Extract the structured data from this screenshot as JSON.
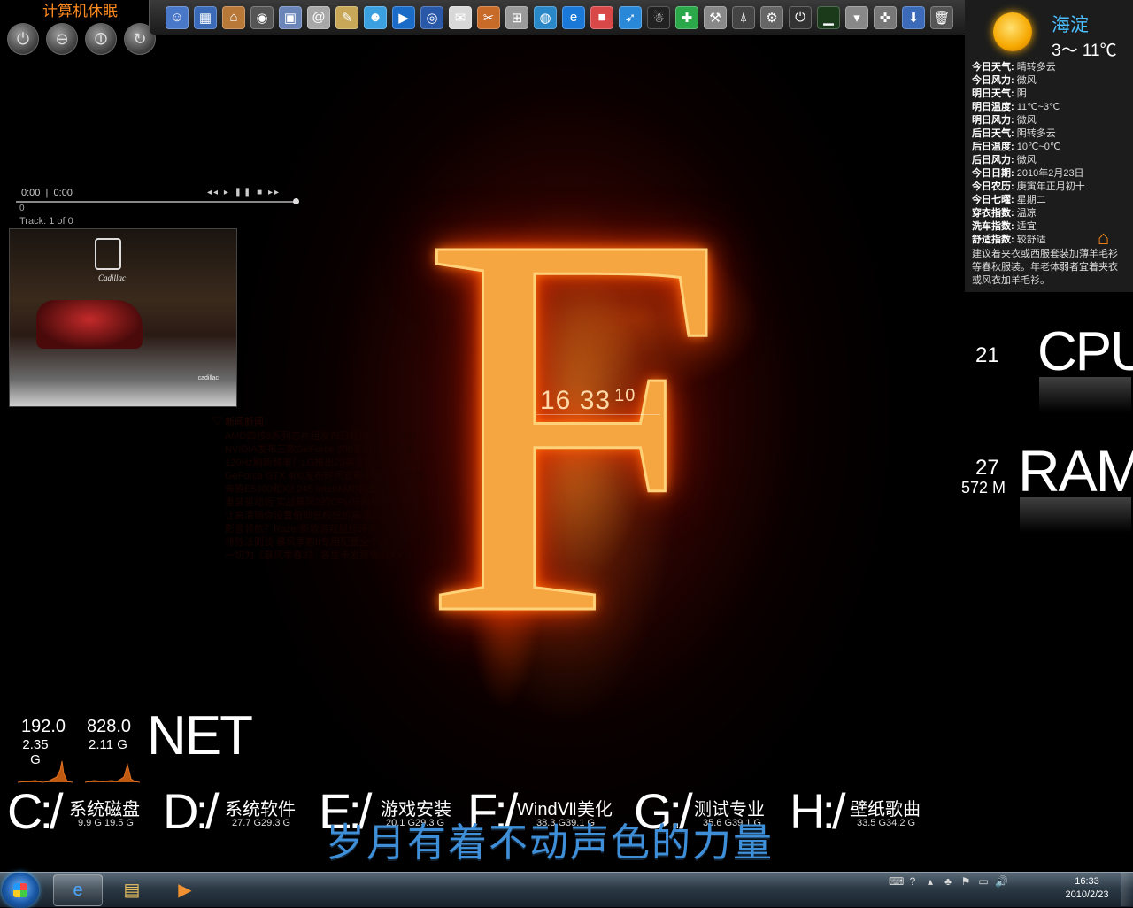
{
  "desktop": {
    "flame_clock": {
      "hm": "16 33",
      "sec": "10"
    },
    "slogan": "岁月有着不动声色的力量"
  },
  "shutdown_gadget": {
    "title": "计算机休眠",
    "buttons": [
      {
        "name": "shutdown",
        "glyph": "⏻"
      },
      {
        "name": "logoff",
        "glyph": "⊖"
      },
      {
        "name": "restart",
        "glyph": "⏼"
      },
      {
        "name": "refresh",
        "glyph": "↻"
      }
    ]
  },
  "dock": {
    "items": [
      {
        "name": "finder-icon",
        "glyph": "☺",
        "color": "#4a78c8"
      },
      {
        "name": "windows-icon",
        "glyph": "▦",
        "color": "#3a6ab8"
      },
      {
        "name": "home-icon",
        "glyph": "⌂",
        "color": "#b87838"
      },
      {
        "name": "gauge-icon",
        "glyph": "◉",
        "color": "#555555"
      },
      {
        "name": "photo-icon",
        "glyph": "▣",
        "color": "#6a86b8"
      },
      {
        "name": "mail-icon",
        "glyph": "@",
        "color": "#a8a8a8"
      },
      {
        "name": "note-icon",
        "glyph": "✎",
        "color": "#c8a858"
      },
      {
        "name": "msn-icon",
        "glyph": "☻",
        "color": "#3aa0e0"
      },
      {
        "name": "play-icon",
        "glyph": "▶",
        "color": "#1a6ac8"
      },
      {
        "name": "browser-icon",
        "glyph": "◎",
        "color": "#2a58a8"
      },
      {
        "name": "document-icon",
        "glyph": "✉",
        "color": "#d8d8d8"
      },
      {
        "name": "ruler-icon",
        "glyph": "✂",
        "color": "#c86a28"
      },
      {
        "name": "calculator-icon",
        "glyph": "⊞",
        "color": "#9a9a9a"
      },
      {
        "name": "globe-icon",
        "glyph": "◍",
        "color": "#2a88c8"
      },
      {
        "name": "ie-icon",
        "glyph": "e",
        "color": "#1a78d8"
      },
      {
        "name": "cube-icon",
        "glyph": "■",
        "color": "#d84848"
      },
      {
        "name": "bird-icon",
        "glyph": "➶",
        "color": "#2a88d8"
      },
      {
        "name": "qq-icon",
        "glyph": "☃",
        "color": "#222222"
      },
      {
        "name": "shield-icon",
        "glyph": "✚",
        "color": "#2aa84a"
      },
      {
        "name": "tools-icon",
        "glyph": "⚒",
        "color": "#888888"
      },
      {
        "name": "hanger-icon",
        "glyph": "⍋",
        "color": "#444444"
      },
      {
        "name": "settings-icon",
        "glyph": "⚙",
        "color": "#666666"
      },
      {
        "name": "power-icon",
        "glyph": "⏻",
        "color": "#333333"
      },
      {
        "name": "chart-icon",
        "glyph": "▁",
        "color": "#1a3a1a"
      },
      {
        "name": "arrow-icon",
        "glyph": "▾",
        "color": "#888888"
      },
      {
        "name": "gamepad-icon",
        "glyph": "✜",
        "color": "#777777"
      },
      {
        "name": "download-icon",
        "glyph": "⬇",
        "color": "#3a6ab8"
      },
      {
        "name": "trash-icon",
        "glyph": "🗑",
        "color": "#555555"
      }
    ]
  },
  "player": {
    "time_current": "0:00",
    "time_total": "0:00",
    "controls": "◂◂ ▸ ❚❚ ■ ▸▸",
    "counter": "0",
    "track": "Track: 1 of 0"
  },
  "photo": {
    "brand": "Cadillac",
    "brand_small": "cadillac"
  },
  "news": {
    "header": "▽ 新闻新闻",
    "items": [
      "AMD四核8系列芯片组发布日程确定 4月26日",
      "NVIDIA发布三款GeForce 300系列OEM显卡",
      "120Hz刷新频率！LG推出23英寸3D液晶",
      "GeForce GTX 400发布时间宣布 将等待一个月",
      "奔腾E5300和X2 245 Intel/AMD销量王PK",
      "重装驱动后 实战暴风2的CPU与内存需求",
      "让高清随你设置俯仰低权低价高清显卡推荐",
      "影音领航？Razer新款游戏鼠标评测",
      "排除法则谈 暴风季春II专用配置全个评",
      "一切为《暴风季春2》 各显卡发挥情况大PK"
    ]
  },
  "weather": {
    "city": "海淀",
    "temp": "3～ 11℃",
    "rows": [
      {
        "k": "今日天气:",
        "v": "晴转多云"
      },
      {
        "k": "今日风力:",
        "v": "微风"
      },
      {
        "k": "明日天气:",
        "v": "阴"
      },
      {
        "k": "明日温度:",
        "v": "11℃~3℃"
      },
      {
        "k": "明日风力:",
        "v": "微风"
      },
      {
        "k": "后日天气:",
        "v": "阴转多云"
      },
      {
        "k": "后日温度:",
        "v": "10℃~0℃"
      },
      {
        "k": "后日风力:",
        "v": "微风"
      },
      {
        "k": "今日日期:",
        "v": "2010年2月23日"
      },
      {
        "k": "今日农历:",
        "v": "庚寅年正月初十"
      },
      {
        "k": "今日七曜:",
        "v": "星期二"
      },
      {
        "k": "穿衣指数:",
        "v": "温凉"
      },
      {
        "k": "洗车指数:",
        "v": "适宜"
      },
      {
        "k": "舒适指数:",
        "v": "较舒适"
      }
    ],
    "advice": "建议着夹衣或西服套装加薄羊毛衫等春秋服装。年老体弱者宜着夹衣或风衣加羊毛衫。"
  },
  "meters": {
    "cpu": {
      "label": "CPU",
      "value": "21"
    },
    "ram": {
      "label": "RAM",
      "value": "27",
      "sub": "572 M"
    },
    "net": {
      "label": "NET",
      "down": "192.0",
      "down_total": "2.35 G",
      "up": "828.0",
      "up_total": "2.11 G"
    }
  },
  "drives": [
    {
      "letter": "C:/",
      "name": "系统磁盘",
      "size": "9.9 G 19.5 G"
    },
    {
      "letter": "D:/",
      "name": "系统软件",
      "size": "27.7 G29.3 G"
    },
    {
      "letter": "E:/",
      "name": "游戏安装",
      "size": "20.1 G29.3 G"
    },
    {
      "letter": "F:/",
      "name": "WindⅦ美化",
      "size": "38.3 G39.1 G"
    },
    {
      "letter": "G:/",
      "name": "测试专业",
      "size": "35.6 G39.1 G"
    },
    {
      "letter": "H:/",
      "name": "壁纸歌曲",
      "size": "33.5 G34.2 G"
    }
  ],
  "taskbar": {
    "pinned": [
      {
        "name": "ie",
        "glyph": "e",
        "color": "#4aa8ff",
        "active": true
      },
      {
        "name": "explorer",
        "glyph": "▤",
        "color": "#e8c060",
        "active": false
      },
      {
        "name": "media",
        "glyph": "▶",
        "color": "#f09030",
        "active": false
      }
    ],
    "tray": [
      "⌨",
      "?",
      "▴",
      "♣",
      "⚑",
      "▭",
      "🔊"
    ],
    "time": "16:33",
    "date": "2010/2/23"
  }
}
